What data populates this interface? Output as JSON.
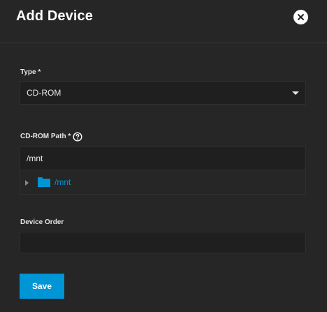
{
  "dialog": {
    "title": "Add Device",
    "close_icon": "close-icon"
  },
  "type_field": {
    "label": "Type *",
    "value": "CD-ROM",
    "icon": "chevron-down-icon"
  },
  "cdrom_path_field": {
    "label": "CD-ROM Path *",
    "help_icon": "help-icon",
    "value": "/mnt",
    "tree": [
      {
        "label": "/mnt",
        "expanded": false,
        "icon": "folder-icon"
      }
    ]
  },
  "device_order_field": {
    "label": "Device Order",
    "value": ""
  },
  "actions": {
    "save_label": "Save"
  },
  "colors": {
    "background": "#262626",
    "input_background": "#1f1f1f",
    "accent": "#0095d5",
    "text": "#e6e6e6"
  }
}
